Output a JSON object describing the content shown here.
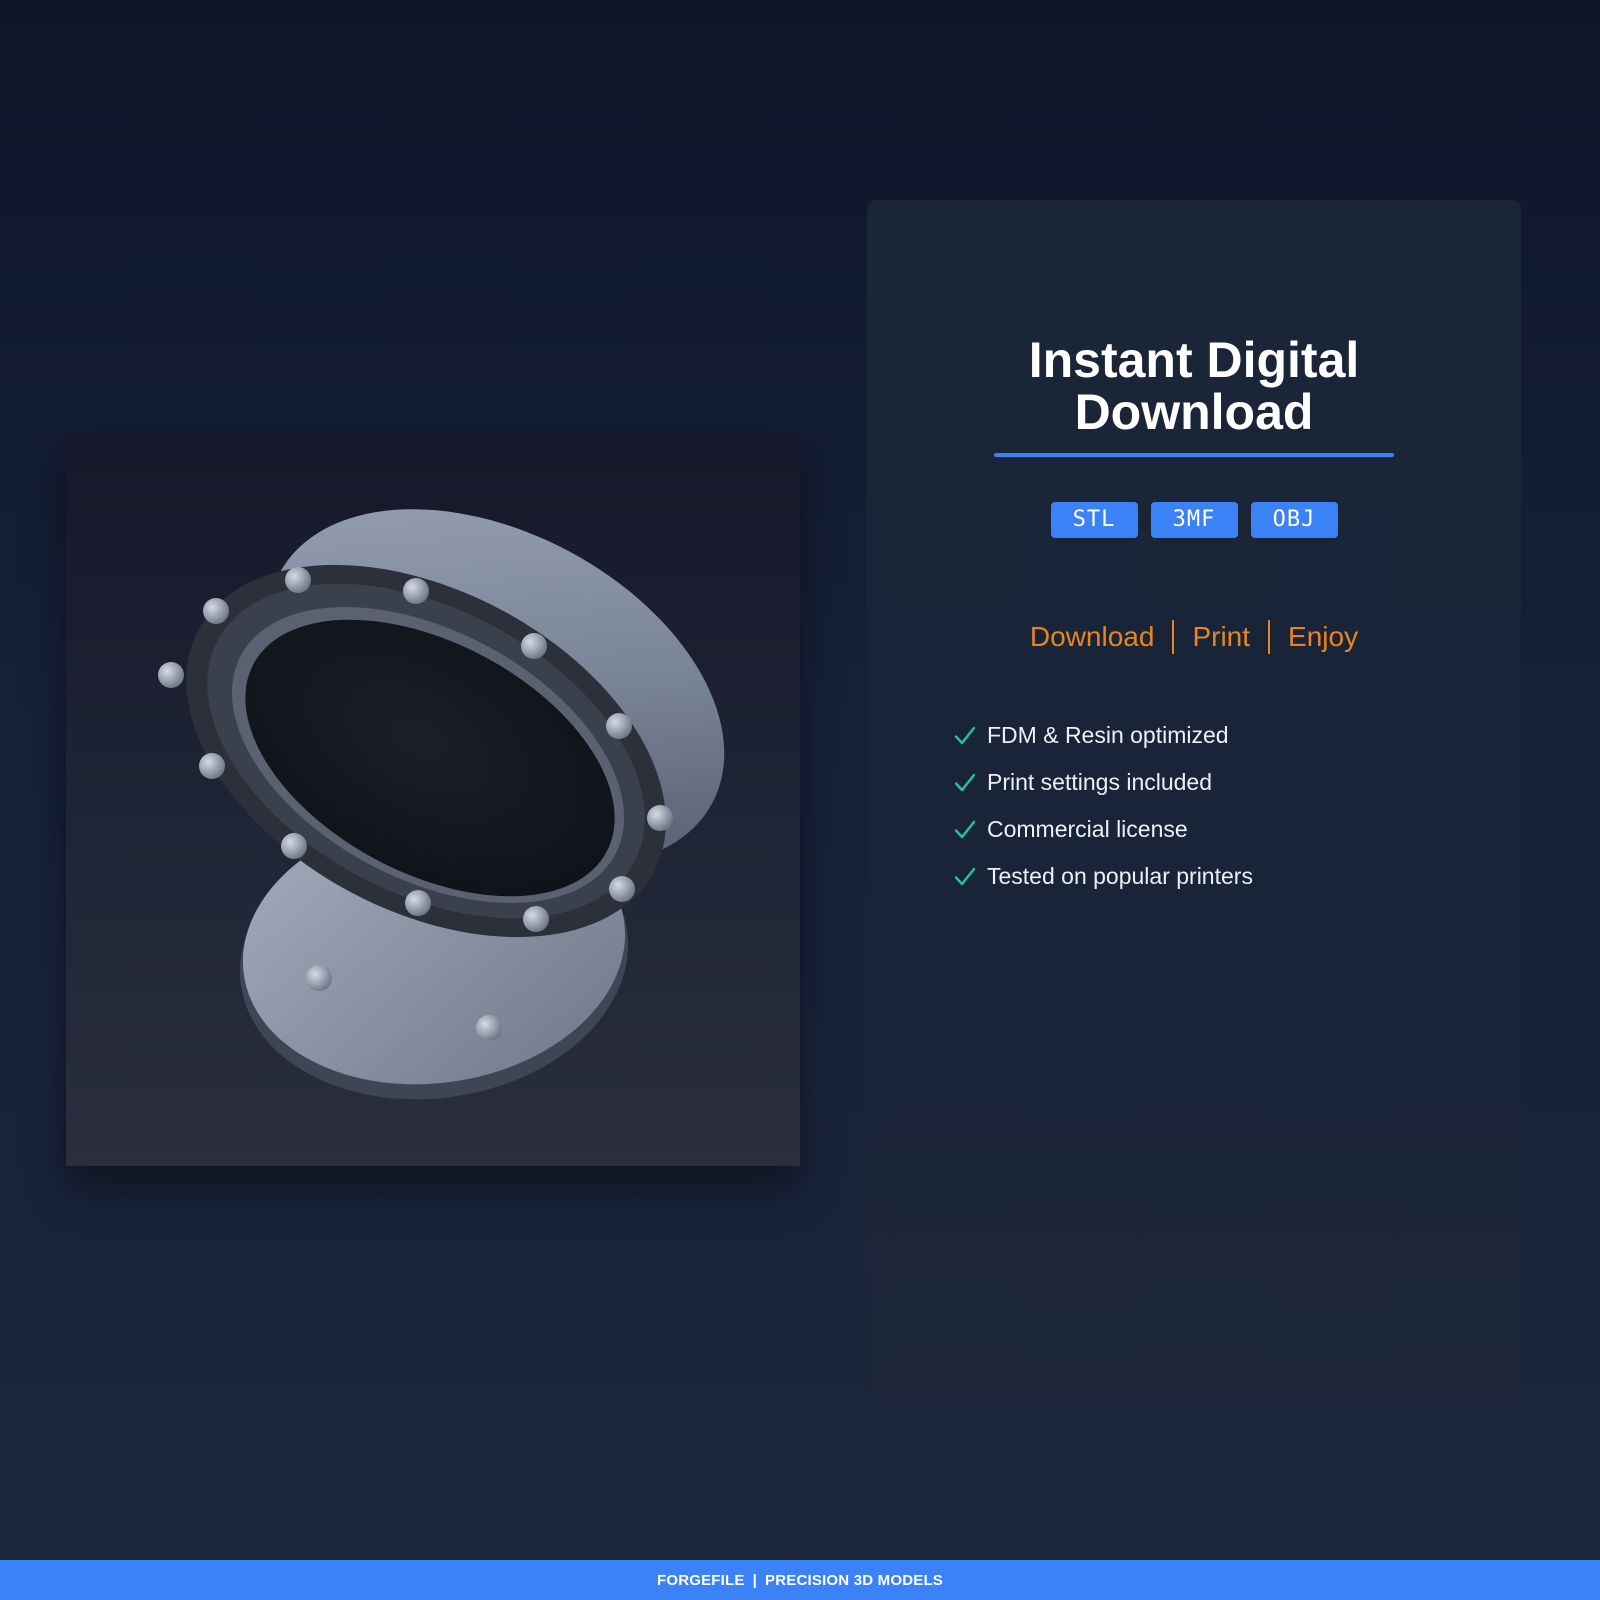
{
  "product": {
    "image_icon": "flange-model-render"
  },
  "card": {
    "title_line1": "Instant Digital",
    "title_line2": "Download",
    "formats": [
      "STL",
      "3MF",
      "OBJ"
    ],
    "steps": [
      "Download",
      "Print",
      "Enjoy"
    ],
    "features": [
      "FDM & Resin optimized",
      "Print settings included",
      "Commercial license",
      "Tested on popular printers"
    ],
    "feature_icon": "check-icon"
  },
  "footer": {
    "brand": "FORGEFILE",
    "separator": "|",
    "tagline": "PRECISION 3D MODELS"
  },
  "colors": {
    "accent_blue": "#3b82f6",
    "steps_orange": "#e8851f",
    "check_teal": "#22c3a0",
    "background": "#101a2e"
  }
}
